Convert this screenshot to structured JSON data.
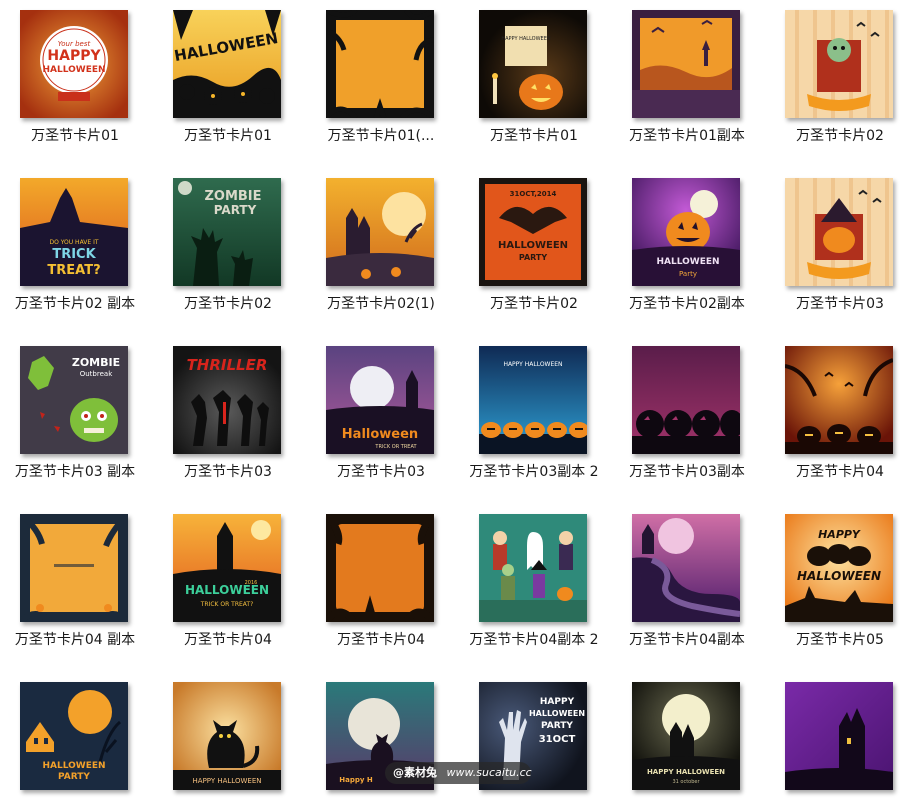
{
  "files": [
    {
      "label": "万圣节卡片01",
      "art": "happy-card"
    },
    {
      "label": "万圣节卡片01",
      "art": "halloween-yellow"
    },
    {
      "label": "万圣节卡片01(...",
      "art": "frame-orange"
    },
    {
      "label": "万圣节卡片01",
      "art": "scroll-pumpkin"
    },
    {
      "label": "万圣节卡片01副本",
      "art": "castle-orange"
    },
    {
      "label": "万圣节卡片02",
      "art": "zombie-door"
    },
    {
      "label": "万圣节卡片02 副本",
      "art": "trick-treat"
    },
    {
      "label": "万圣节卡片02",
      "art": "zombie-party"
    },
    {
      "label": "万圣节卡片02(1)",
      "art": "castle-moon"
    },
    {
      "label": "万圣节卡片02",
      "art": "bat-poster"
    },
    {
      "label": "万圣节卡片02副本",
      "art": "purple-pumpkin"
    },
    {
      "label": "万圣节卡片03",
      "art": "witch-pumpkin"
    },
    {
      "label": "万圣节卡片03 副本",
      "art": "zombie-outbreak"
    },
    {
      "label": "万圣节卡片03",
      "art": "thriller"
    },
    {
      "label": "万圣节卡片03",
      "art": "halloween-moon"
    },
    {
      "label": "万圣节卡片03副本 2",
      "art": "blue-pumpkins"
    },
    {
      "label": "万圣节卡片03副本",
      "art": "dark-pumpkins"
    },
    {
      "label": "万圣节卡片04",
      "art": "red-pumpkins"
    },
    {
      "label": "万圣节卡片04 副本",
      "art": "orange-frame-navy"
    },
    {
      "label": "万圣节卡片04",
      "art": "castle-green"
    },
    {
      "label": "万圣节卡片04",
      "art": "grunge-frame"
    },
    {
      "label": "万圣节卡片04副本 2",
      "art": "kids-costumes"
    },
    {
      "label": "万圣节卡片04副本",
      "art": "purple-road"
    },
    {
      "label": "万圣节卡片05",
      "art": "happy-halloween-pumpkins"
    },
    {
      "label": "",
      "art": "haunted-house"
    },
    {
      "label": "",
      "art": "black-cat"
    },
    {
      "label": "",
      "art": "cat-teal"
    },
    {
      "label": "",
      "art": "zombie-hand"
    },
    {
      "label": "",
      "art": "moon-castle"
    },
    {
      "label": "",
      "art": "purple-house"
    }
  ],
  "thumb_text": {
    "happy_1": "Your best",
    "happy_2": "HAPPY",
    "happy_3": "HALLOWEEN",
    "halloween": "HALLOWEEN",
    "scroll": "HAPPY HALLOWEEN",
    "trick_1": "DO YOU HAVE IT",
    "trick_2": "TRICK",
    "trick_3": "TREAT?",
    "zombie_party_1": "ZOMBIE",
    "zombie_party_2": "PARTY",
    "bat_date": "31OCT,2014",
    "bat_title": "HALLOWEEN",
    "bat_party": "PARTY",
    "purple_title": "HALLOWEEN",
    "purple_party": "Party",
    "zombie_1": "ZOMBIE",
    "zombie_2": "Outbreak",
    "thriller": "THRILLER",
    "halloween_script": "Halloween",
    "trick_or_treat": "TRICK OR TREAT",
    "blue_title": "HAPPY HALLOWEEN",
    "green_title": "HALLOWEEN",
    "green_year": "2016",
    "green_sub": "TRICK OR TREAT?",
    "p05_1": "HAPPY",
    "p05_2": "HALLOWEEN",
    "house_1": "HALLOWEEN",
    "house_2": "PARTY",
    "cat_text": "HAPPY HALLOWEEN",
    "teal_text": "Happy H",
    "hand_1": "HAPPY",
    "hand_2": "HALLOWEEN",
    "hand_3": "PARTY",
    "hand_4": "31OCT",
    "moon_1": "HAPPY HALLOWEEN",
    "moon_2": "31 october"
  },
  "watermark": {
    "logo": "@素材兔",
    "url": "www.sucaitu.cc"
  }
}
